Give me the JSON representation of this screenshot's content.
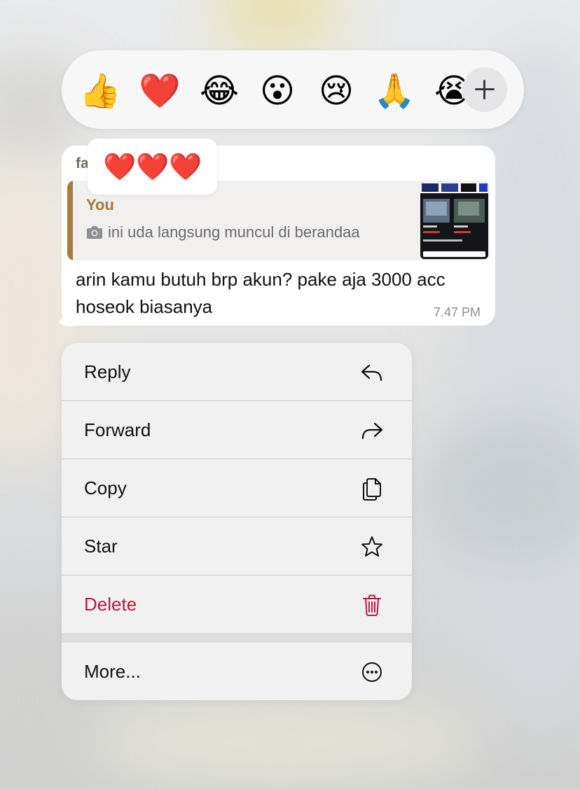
{
  "reactions": {
    "emojis": [
      {
        "name": "thumbs-up-emoji",
        "glyph": "👍"
      },
      {
        "name": "red-heart-emoji",
        "glyph": "❤️"
      },
      {
        "name": "tears-of-joy-emoji",
        "glyph": "😂"
      },
      {
        "name": "surprised-emoji",
        "glyph": "😮"
      },
      {
        "name": "crying-emoji",
        "glyph": "😢"
      },
      {
        "name": "folded-hands-emoji",
        "glyph": "🙏"
      },
      {
        "name": "loudly-crying-emoji",
        "glyph": "😭"
      }
    ],
    "more_icon": "plus-icon"
  },
  "message": {
    "sender": "fa",
    "heart_reactions": [
      "❤️",
      "❤️",
      "❤️"
    ],
    "quote": {
      "author": "You",
      "text": "ini uda langsung muncul di berandaa",
      "media_icon": "camera-icon"
    },
    "text": "arin kamu butuh brp akun? pake aja 3000 acc hoseok biasanya",
    "time": "7.47 PM"
  },
  "menu": {
    "items": [
      {
        "label": "Reply",
        "icon": "reply-arrow-icon"
      },
      {
        "label": "Forward",
        "icon": "forward-arrow-icon"
      },
      {
        "label": "Copy",
        "icon": "copy-icon"
      },
      {
        "label": "Star",
        "icon": "star-icon"
      },
      {
        "label": "Delete",
        "icon": "trash-icon",
        "color": "#c0183f"
      },
      {
        "label": "More...",
        "icon": "more-ellipsis-icon"
      }
    ]
  },
  "colors": {
    "quote_accent": "#a67c40",
    "delete_red": "#c0183f",
    "heart_red": "#e2231a"
  }
}
